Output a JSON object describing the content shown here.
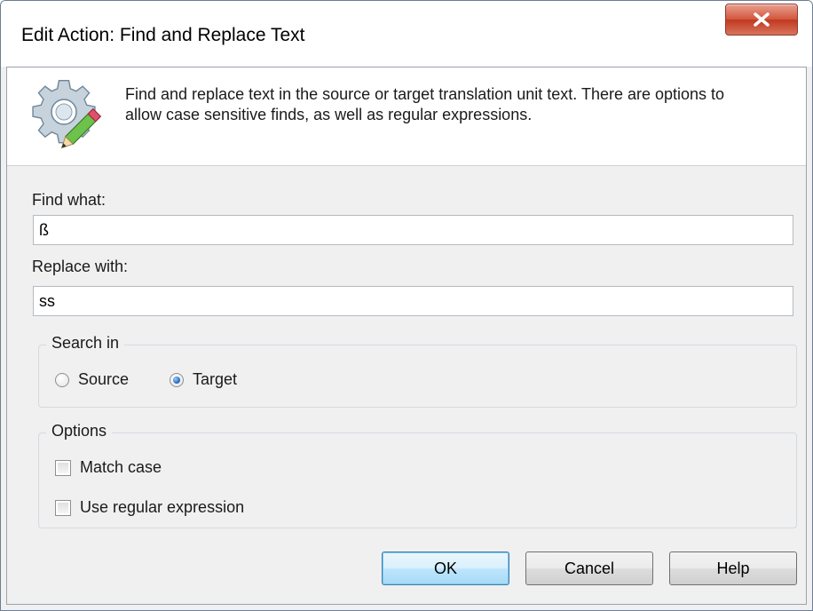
{
  "window": {
    "title": "Edit Action: Find and Replace Text"
  },
  "header": {
    "description": "Find and replace text in the source or target translation unit text. There are options to allow case sensitive finds, as well as regular expressions.",
    "icon": "gear-pencil-icon"
  },
  "find": {
    "label": "Find what:",
    "value": "ß"
  },
  "replace": {
    "label": "Replace with:",
    "value": "ss"
  },
  "search_in": {
    "title": "Search in",
    "options": [
      {
        "label": "Source",
        "selected": false
      },
      {
        "label": "Target",
        "selected": true
      }
    ]
  },
  "options_group": {
    "title": "Options",
    "match_case": {
      "label": "Match case",
      "checked": false
    },
    "regex": {
      "label": "Use regular expression",
      "checked": false
    }
  },
  "buttons": {
    "ok": "OK",
    "cancel": "Cancel",
    "help": "Help"
  },
  "colors": {
    "close_button": "#c7432b",
    "default_button_border": "#3c7fb1",
    "dialog_background": "#f0f0f0"
  }
}
